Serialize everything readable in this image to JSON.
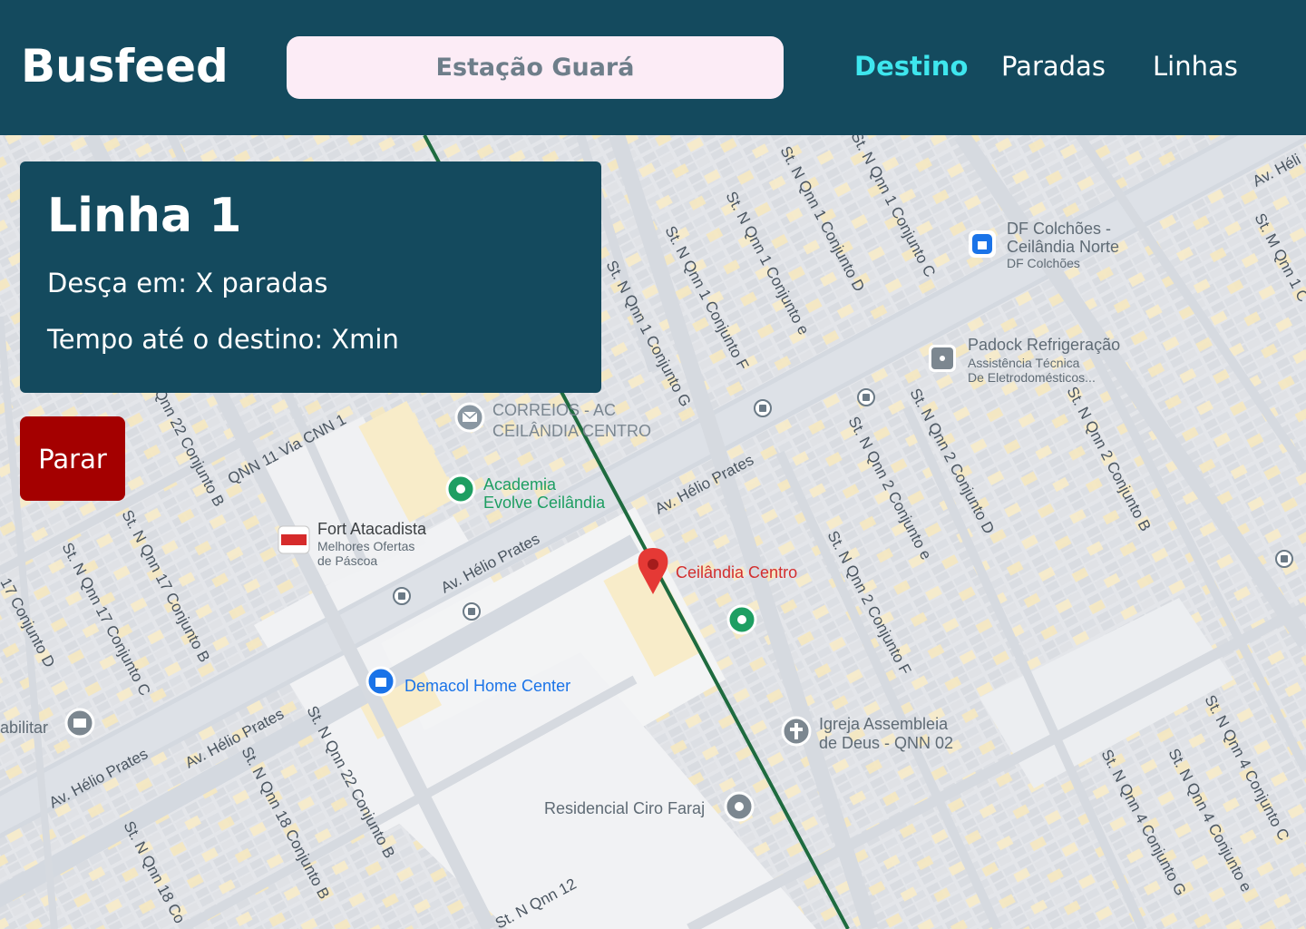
{
  "header": {
    "logo": "Busfeed",
    "search_placeholder": "Estação Guará",
    "nav": [
      {
        "label": "Destino",
        "active": true
      },
      {
        "label": "Paradas",
        "active": false
      },
      {
        "label": "Linhas",
        "active": false
      }
    ]
  },
  "info_card": {
    "title": "Linha 1",
    "stops_line": "Desça em:  X paradas",
    "time_line": "Tempo até o destino: Xmin"
  },
  "stop_button": "Parar",
  "map": {
    "pois": {
      "df_colchoes": {
        "name1": "DF Colchões -",
        "name2": "Ceilândia Norte",
        "sub": "DF Colchões"
      },
      "padock": {
        "name": "Padock Refrigeração",
        "sub1": "Assistência Técnica",
        "sub2": "De Eletrodomésticos..."
      },
      "correios": {
        "name1": "CORREIOS - AC",
        "name2": "CEILÂNDIA CENTRO"
      },
      "academia": {
        "name1": "Academia",
        "name2": "Evolve Ceilândia"
      },
      "fort": {
        "name": "Fort Atacadista",
        "sub1": "Melhores Ofertas",
        "sub2": "de Páscoa"
      },
      "ceilandia_centro": {
        "name": "Ceilândia Centro"
      },
      "demacol": {
        "name": "Demacol Home Center"
      },
      "igreja": {
        "name1": "Igreja Assembleia",
        "name2": "de Deus - QNN 02"
      },
      "residencial": {
        "name": "Residencial Ciro Faraj"
      },
      "habilitar": {
        "name": "abilitar"
      }
    },
    "streets": [
      "Av. Hélio Prates",
      "Av. Hélio Prates",
      "Av. Hélio Prates",
      "Av. Hélio Prates",
      "QNN 11 Via CNN 1",
      "St. N Qnn 1 Conjunto G",
      "St. N Qnn 1 Conjunto F",
      "St. N Qnn 1 Conjunto e",
      "St. N Qnn 1 Conjunto D",
      "St. N Qnn 1 Conjunto C",
      "St. N Qnn 2 Conjunto e",
      "St. N Qnn 2 Conjunto D",
      "St. N Qnn 2 Conjunto B",
      "St. N Qnn 2 Conjunto F",
      "Qnn 22 Conjunto B",
      "St. N Qnn 17 Conjunto B",
      "St. N Qnn 17 Conjunto C",
      "17 Conjunto D",
      "St. N Qnn 22 Conjunto B",
      "St. N Qnn 18 Conjunto B",
      "St. N Qnn 18 Co",
      "St. N Qnn 4 Conjunto G",
      "St. N Qnn 4 Conjunto e",
      "St. N Qnn 4 Conjunto C",
      "St. N Qnn 12",
      "Av. Héli",
      "St. M Qnn 1 C"
    ]
  }
}
